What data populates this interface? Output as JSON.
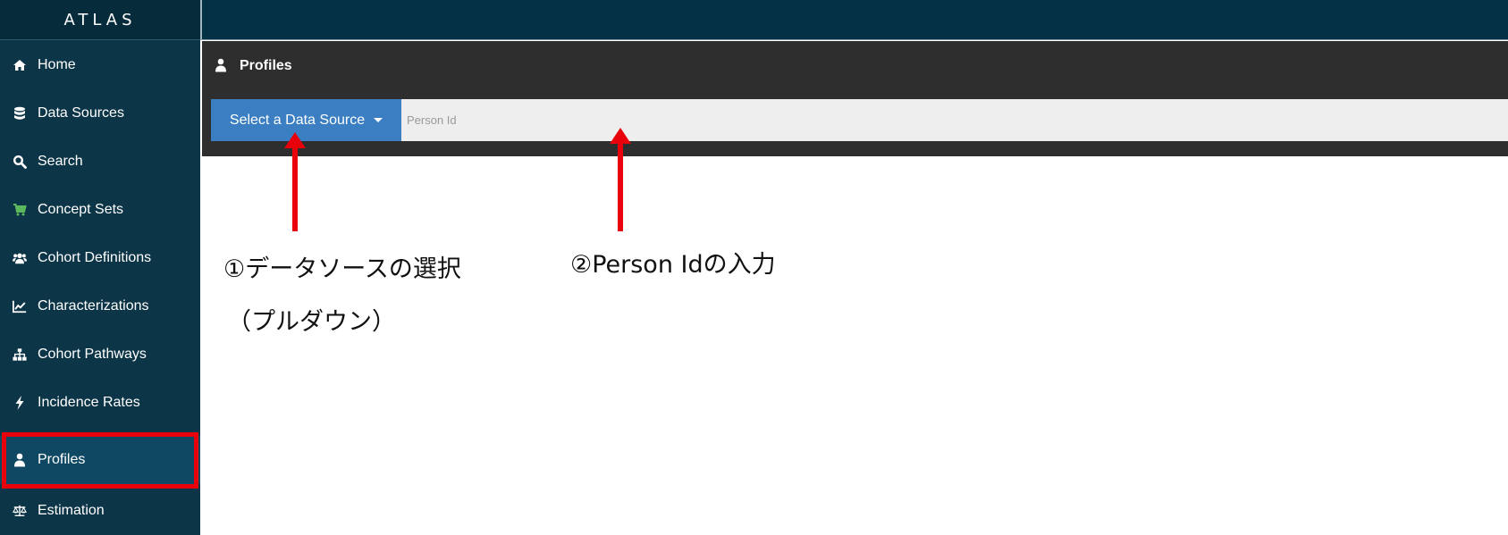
{
  "app": {
    "brand": "ATLAS"
  },
  "sidebar": {
    "items": [
      {
        "label": "Home",
        "icon": "home-icon"
      },
      {
        "label": "Data Sources",
        "icon": "database-icon"
      },
      {
        "label": "Search",
        "icon": "search-icon"
      },
      {
        "label": "Concept Sets",
        "icon": "cart-icon"
      },
      {
        "label": "Cohort Definitions",
        "icon": "users-icon"
      },
      {
        "label": "Characterizations",
        "icon": "line-chart-icon"
      },
      {
        "label": "Cohort Pathways",
        "icon": "sitemap-icon"
      },
      {
        "label": "Incidence Rates",
        "icon": "bolt-icon"
      },
      {
        "label": "Profiles",
        "icon": "user-icon",
        "active": true
      },
      {
        "label": "Estimation",
        "icon": "balance-scale-icon"
      }
    ]
  },
  "page": {
    "title": "Profiles"
  },
  "toolbar": {
    "data_source_label": "Select a Data Source",
    "person_id_placeholder": "Person Id"
  },
  "annotations": {
    "note1_line1": "①データソースの選択",
    "note1_line2": "（プルダウン）",
    "note2": "②Person Idの入力"
  },
  "colors": {
    "sidebar_bg": "#0d3548",
    "header_bg": "#2e2e2e",
    "button_blue": "#3b7fc2",
    "annotation_red": "#e8000b",
    "concept_sets_icon": "#5cb85c"
  }
}
